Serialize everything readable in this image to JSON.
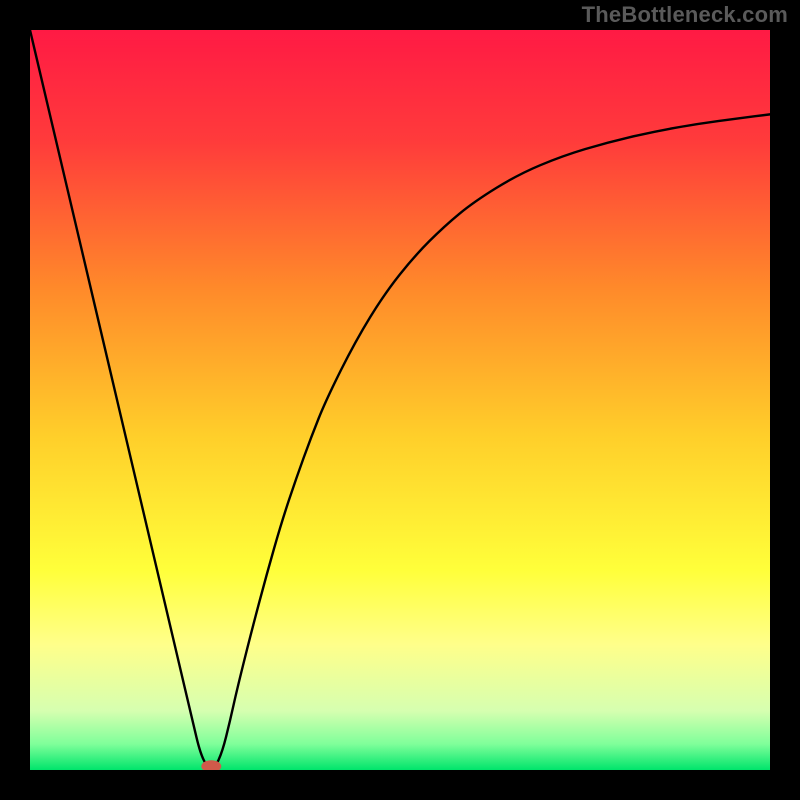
{
  "attribution": "TheBottleneck.com",
  "chart_data": {
    "type": "line",
    "title": "",
    "xlabel": "",
    "ylabel": "",
    "xlim": [
      0,
      100
    ],
    "ylim": [
      0,
      100
    ],
    "grid": false,
    "legend": false,
    "gradient_stops": [
      {
        "offset": 0.0,
        "color": "#ff1a44"
      },
      {
        "offset": 0.15,
        "color": "#ff3b3b"
      },
      {
        "offset": 0.35,
        "color": "#ff8a2a"
      },
      {
        "offset": 0.55,
        "color": "#ffcf2a"
      },
      {
        "offset": 0.73,
        "color": "#ffff3a"
      },
      {
        "offset": 0.83,
        "color": "#ffff8a"
      },
      {
        "offset": 0.92,
        "color": "#d6ffb0"
      },
      {
        "offset": 0.965,
        "color": "#7fff9a"
      },
      {
        "offset": 1.0,
        "color": "#00e56b"
      }
    ],
    "series": [
      {
        "name": "bottleneck-curve",
        "x": [
          0,
          2,
          4,
          6,
          8,
          10,
          12,
          14,
          16,
          18,
          20,
          22,
          23,
          24,
          25,
          26,
          27,
          28,
          30,
          32,
          34,
          36,
          38,
          40,
          44,
          48,
          52,
          56,
          60,
          66,
          72,
          78,
          84,
          90,
          96,
          100
        ],
        "y": [
          100,
          91.5,
          83,
          74.5,
          66,
          57.5,
          49,
          40.5,
          32,
          23.5,
          15,
          6.5,
          2.3,
          0.3,
          0.3,
          2.5,
          6.5,
          11,
          19,
          26.5,
          33.5,
          39.5,
          45,
          50,
          58,
          64.5,
          69.5,
          73.5,
          76.8,
          80.5,
          83,
          84.8,
          86.2,
          87.3,
          88.1,
          88.6
        ]
      }
    ],
    "marker": {
      "name": "minimum-marker",
      "x": 24.5,
      "y": 0.5,
      "color": "#d05a4a",
      "rx": 10,
      "ry": 6
    }
  }
}
